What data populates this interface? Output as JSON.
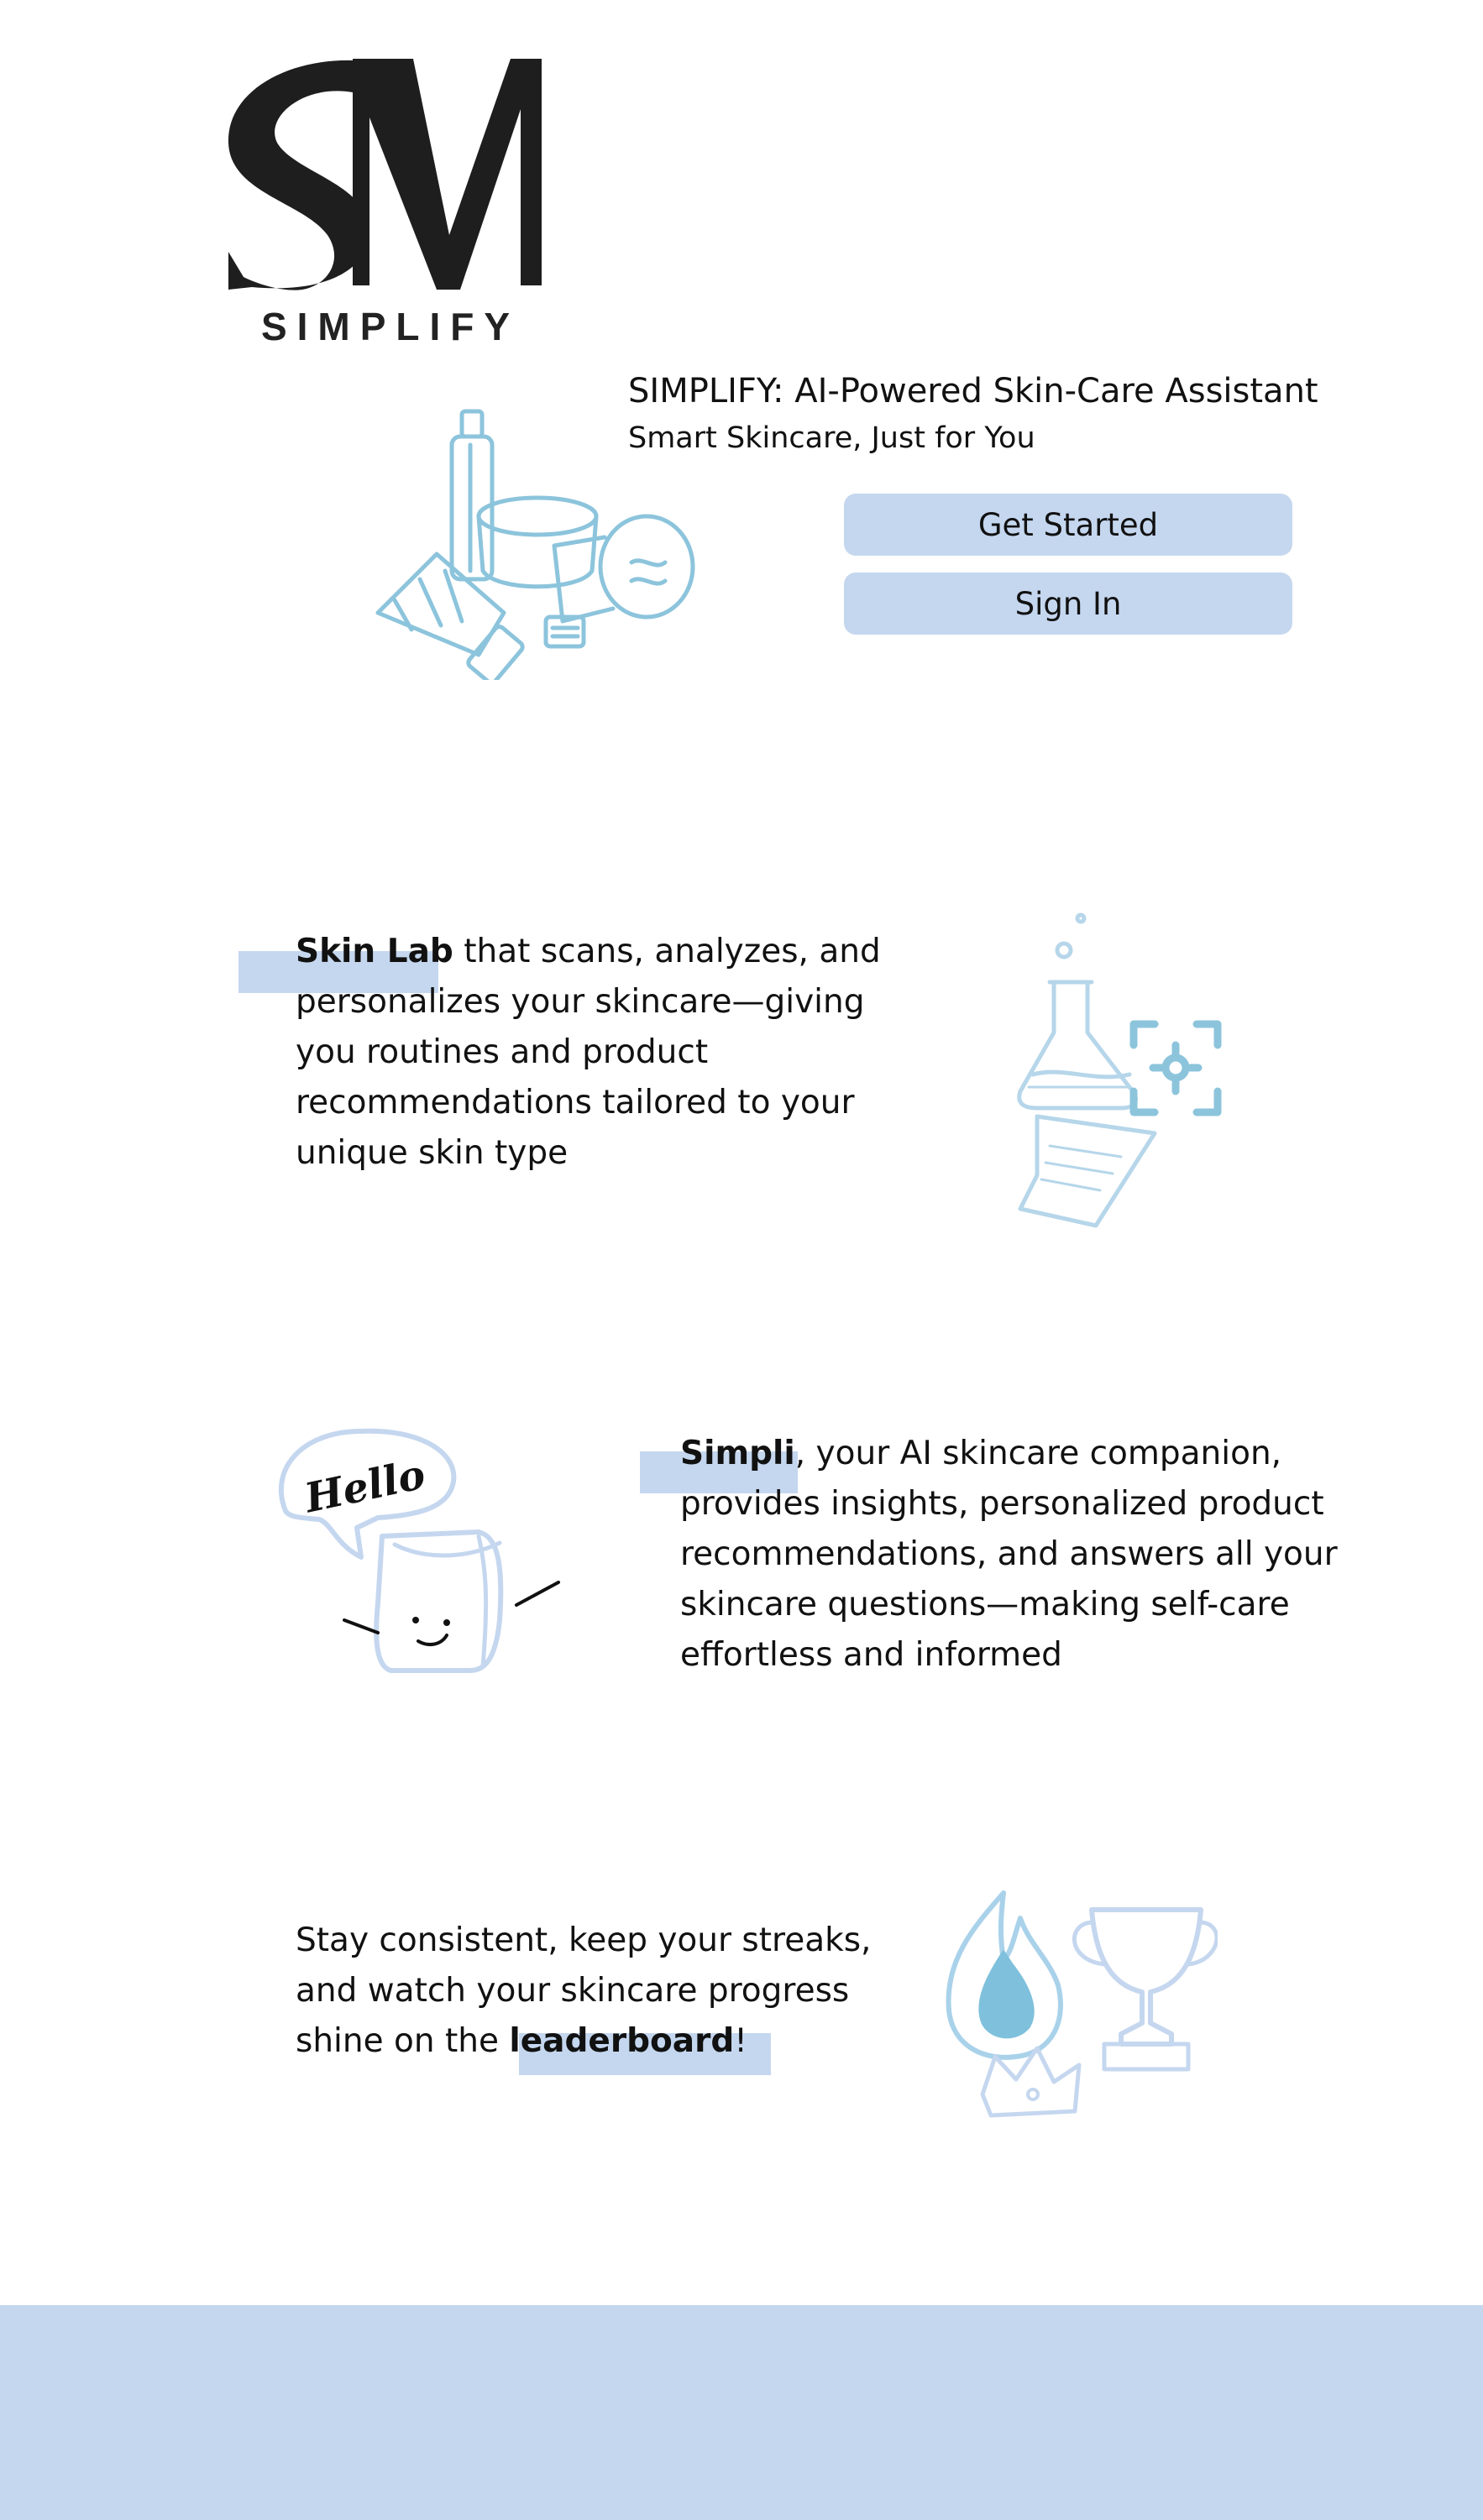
{
  "brand": {
    "monogram": "SM",
    "wordmark": "SIMPLIFY"
  },
  "hero": {
    "title": "SIMPLIFY: AI-Powered Skin-Care Assistant",
    "subtitle": "Smart Skincare, Just for You",
    "illustration_icon": "skincare-products-sketch-icon"
  },
  "actions": {
    "get_started_label": "Get Started",
    "sign_in_label": "Sign In"
  },
  "features": [
    {
      "highlight": "Skin Lab",
      "text": " that scans, analyzes, and personalizes your skincare—giving you routines and product recommendations tailored to your unique skin type",
      "icon": "lab-flask-scan-icon"
    },
    {
      "highlight": "Simpli",
      "text": ", your AI skincare companion, provides insights, personalized product recommendations, and answers all your skincare questions—making self-care effortless and informed",
      "icon": "chat-companion-hello-icon",
      "bubble_text": "Hello"
    },
    {
      "text_before": "Stay consistent, keep your streaks, and watch your skincare progress shine on the ",
      "highlight": "leaderboard",
      "text_after": "!",
      "icon": "streak-trophy-crown-icon"
    }
  ],
  "colors": {
    "accent_blue": "#c5d7ef",
    "sketch_blue": "#8cc4dc",
    "text": "#111111"
  }
}
